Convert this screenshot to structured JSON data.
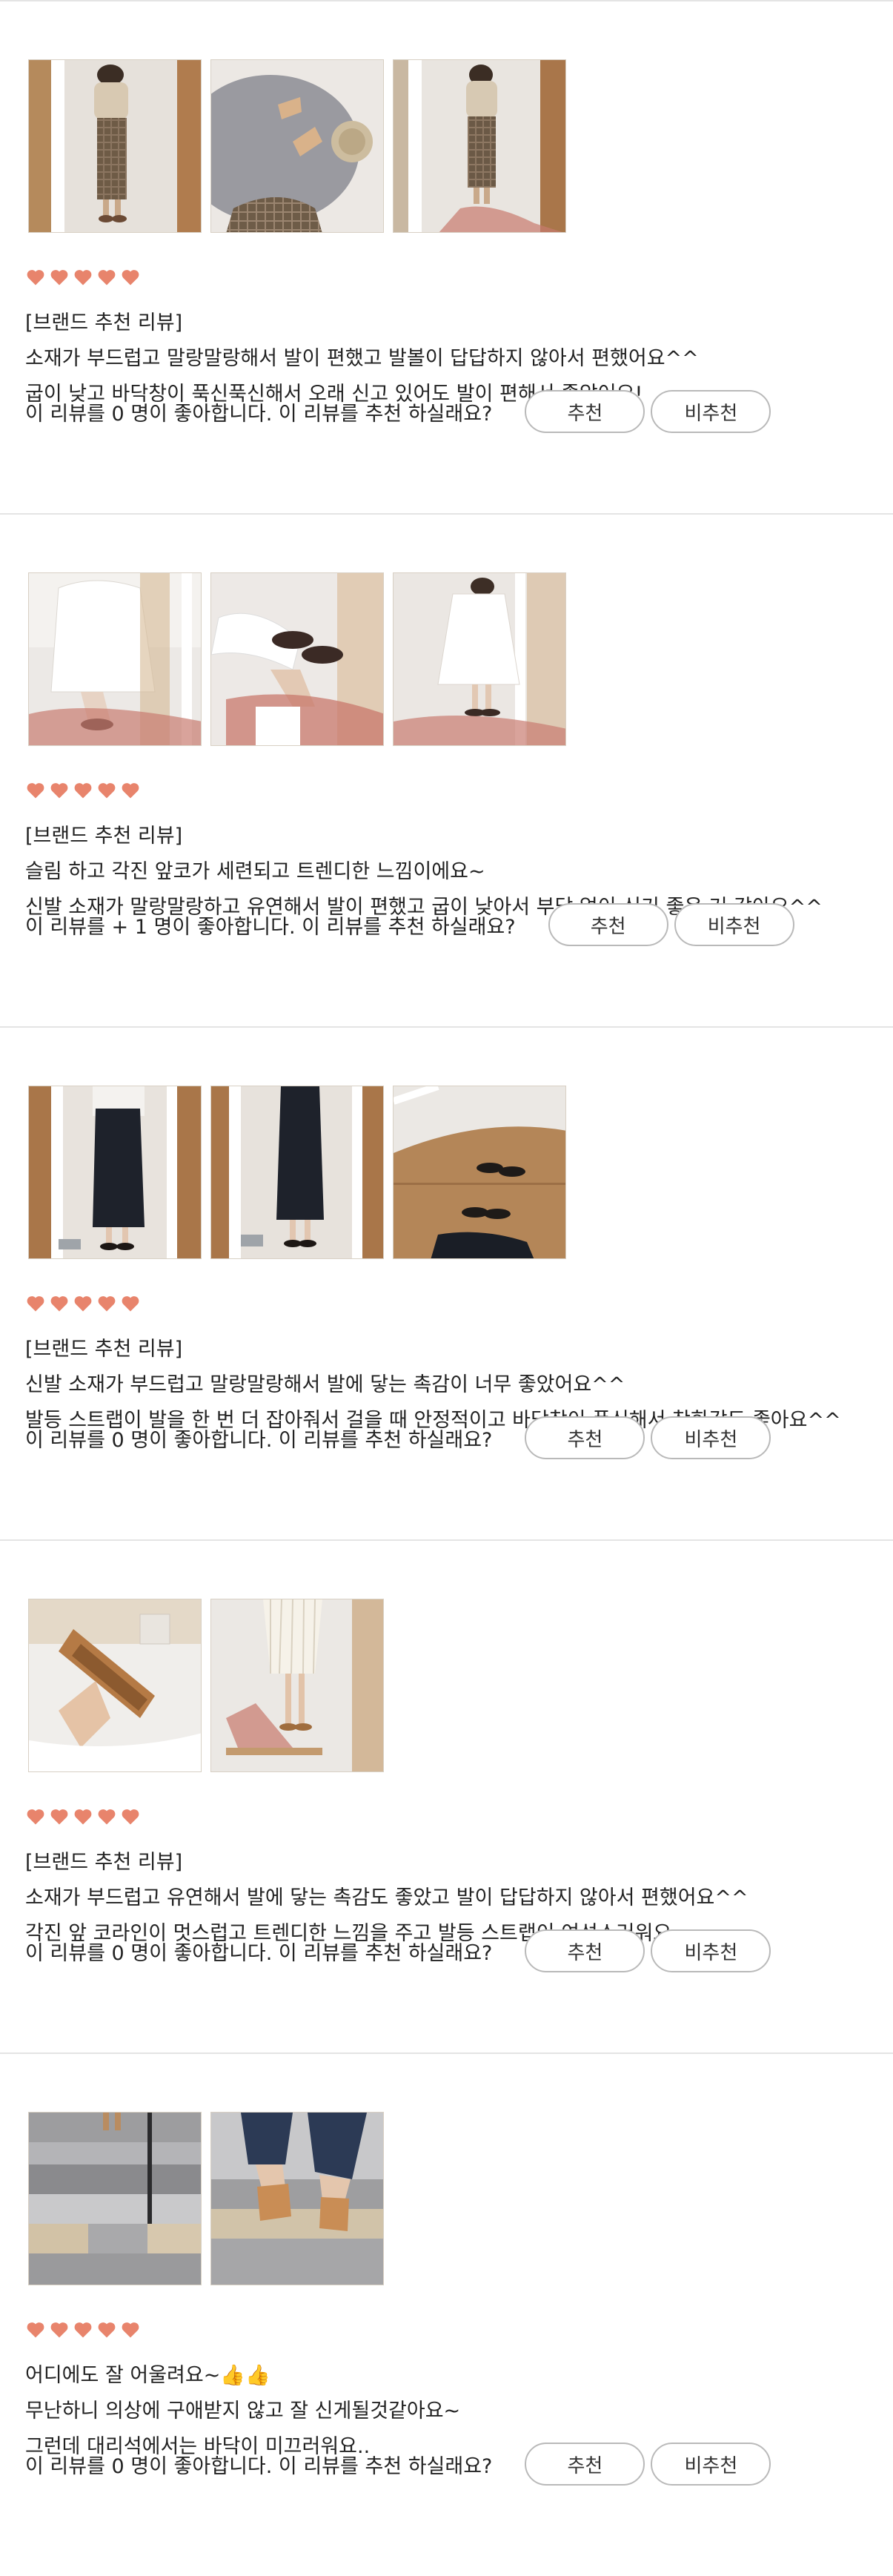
{
  "colors": {
    "heart": "#e8846c",
    "border": "#e4e4e4",
    "button_border": "#b9b9b9"
  },
  "labels": {
    "recommend": "추천",
    "not_recommend": "비추천"
  },
  "reviews": [
    {
      "rating": 5,
      "photos": [
        "photo-mirror-skirt",
        "photo-shoes-rug",
        "photo-mirror-skirt-2"
      ],
      "lines": [
        "[브랜드 추천 리뷰]",
        "소재가 부드럽고 말랑말랑해서 발이 편했고 발볼이 답답하지 않아서 편했어요^^",
        "굽이 낮고 바닥창이 푹신푹신해서 오래 신고 있어도 발이 편해서 좋았어요!"
      ],
      "recommend_question": "이 리뷰를 0 명이 좋아합니다. 이 리뷰를 추천 하실래요?"
    },
    {
      "rating": 5,
      "photos": [
        "photo-white-dress-sitting",
        "photo-shoes-closeup",
        "photo-white-dress-2"
      ],
      "lines": [
        "[브랜드 추천 리뷰]",
        "슬림 하고 각진 앞코가 세련되고 트렌디한 느낌이에요~",
        "신발 소재가 말랑말랑하고 유연해서 발이 편했고 굽이 낮아서 부담 없이 신기 좋은 거 같아요^^"
      ],
      "recommend_question": "이 리뷰를 + 1 명이 좋아합니다. 이 리뷰를 추천 하실래요?"
    },
    {
      "rating": 5,
      "photos": [
        "photo-black-dress",
        "photo-black-dress-2",
        "photo-shoes-floor"
      ],
      "lines": [
        "[브랜드 추천 리뷰]",
        "신발 소재가 부드럽고 말랑말랑해서 발에 닿는 촉감이 너무 좋았어요^^",
        "발등 스트랩이 발을 한 번 더 잡아줘서 걸을 때 안정적이고 바닥창이 푹신해서 착화감도 좋아요^^"
      ],
      "recommend_question": "이 리뷰를 0 명이 좋아합니다. 이 리뷰를 추천 하실래요?"
    },
    {
      "rating": 5,
      "photos": [
        "photo-shoe-in-hand",
        "photo-pleated-skirt"
      ],
      "lines": [
        "[브랜드 추천 리뷰]",
        "소재가 부드럽고 유연해서 발에 닿는 촉감도 좋았고 발이 답답하지 않아서 편했어요^^",
        "각진 앞 코라인이 멋스럽고 트렌디한 느낌을 주고 발등 스트랩이 여성스러워요~"
      ],
      "recommend_question": "이 리뷰를 0 명이 좋아합니다. 이 리뷰를 추천 하실래요?"
    },
    {
      "rating": 5,
      "photos": [
        "photo-tile-floor",
        "photo-jeans-shoes"
      ],
      "lines": [
        "어디에도 잘 어울려요~👍👍",
        "무난하니 의상에 구애받지 않고 잘 신게될것같아요~",
        "그런데 대리석에서는 바닥이 미끄러워요.."
      ],
      "recommend_question": "이 리뷰를 0 명이 좋아합니다. 이 리뷰를 추천 하실래요?"
    }
  ]
}
